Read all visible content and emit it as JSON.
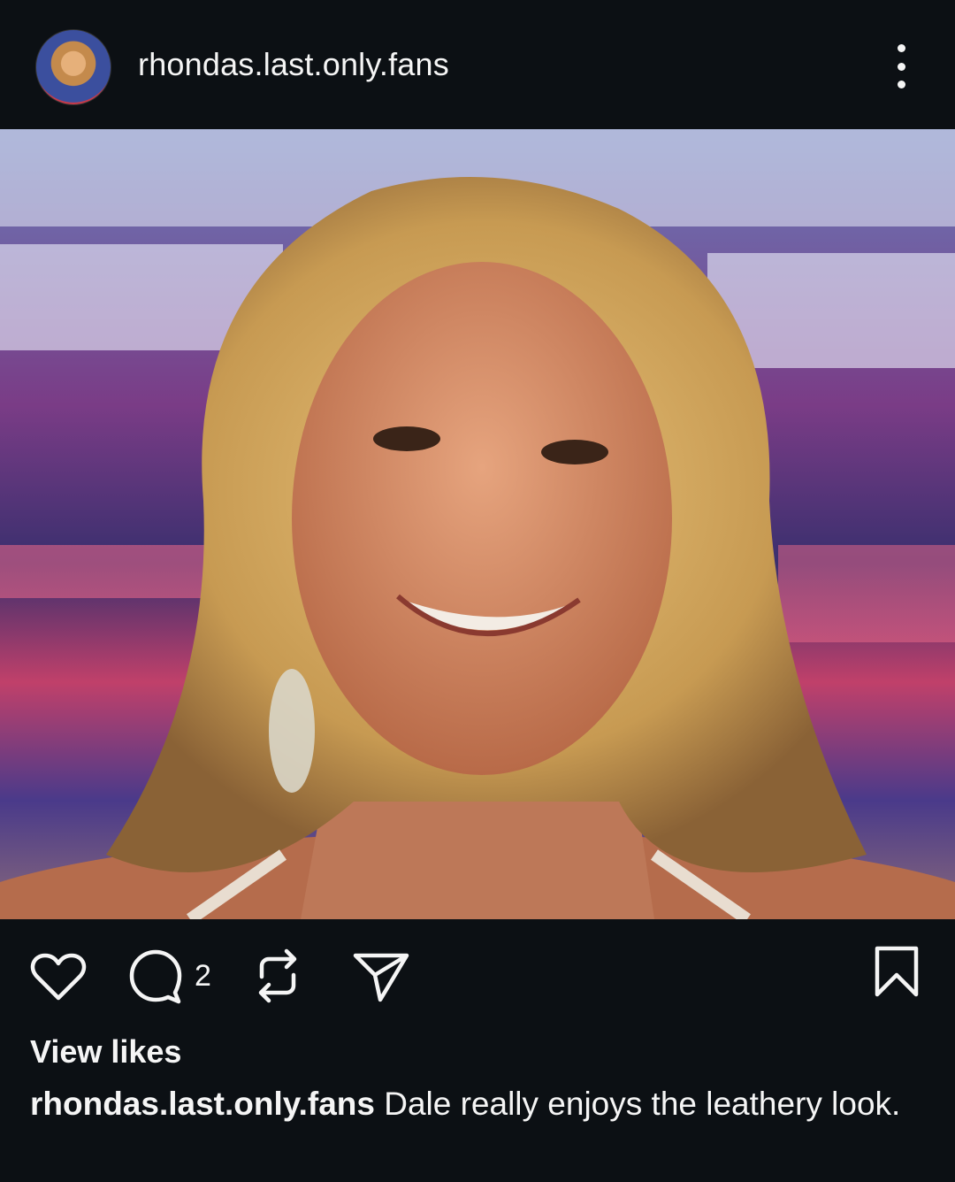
{
  "post": {
    "username": "rhondas.last.only.fans",
    "comment_count": "2",
    "view_likes": "View likes",
    "caption_user": "rhondas.last.only.fans",
    "caption_text": "Dale really enjoys the leathery look."
  },
  "icons": {
    "like": "heart-icon",
    "comment": "comment-icon",
    "repost": "repost-icon",
    "share": "send-icon",
    "save": "bookmark-icon",
    "more": "more-vertical-icon"
  },
  "colors": {
    "background": "#0c1014",
    "text": "#f5f5f5"
  }
}
